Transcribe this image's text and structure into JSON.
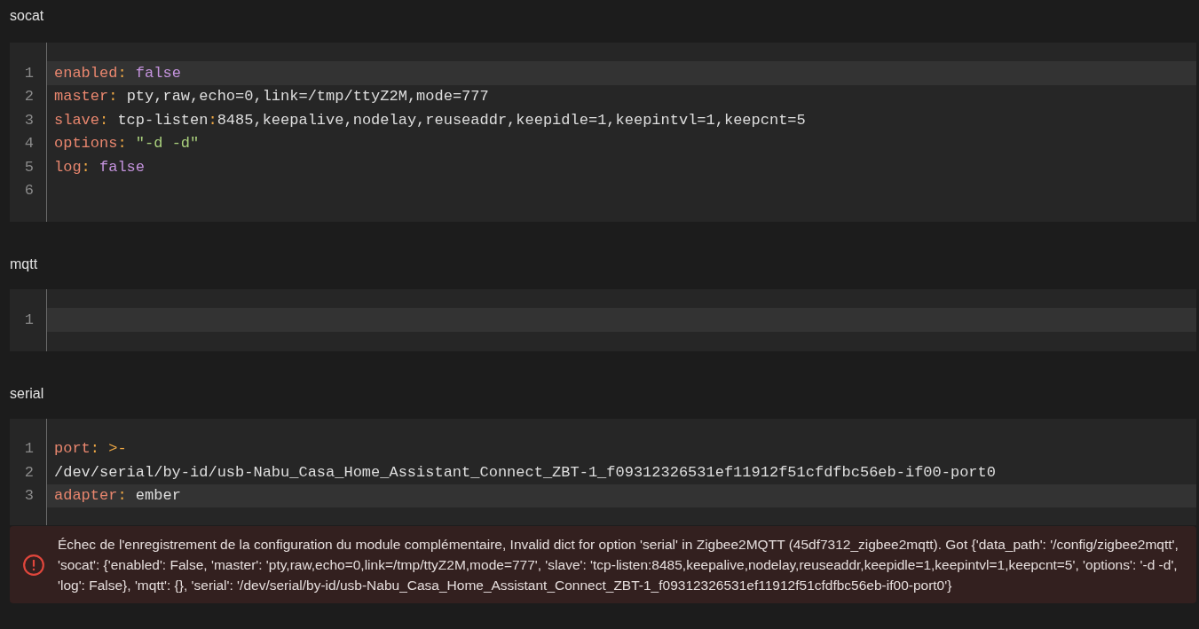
{
  "sections": [
    {
      "title": "socat",
      "lines": [
        {
          "number": "1",
          "active": true,
          "tokens": [
            {
              "kind": "key",
              "text": "enabled"
            },
            {
              "kind": "punct",
              "text": ": "
            },
            {
              "kind": "bool",
              "text": "false"
            }
          ]
        },
        {
          "number": "2",
          "active": false,
          "tokens": [
            {
              "kind": "key",
              "text": "master"
            },
            {
              "kind": "punct",
              "text": ": "
            },
            {
              "kind": "plain",
              "text": "pty,raw,echo=0,link=/tmp/ttyZ2M,mode=777"
            }
          ]
        },
        {
          "number": "3",
          "active": false,
          "tokens": [
            {
              "kind": "key",
              "text": "slave"
            },
            {
              "kind": "punct",
              "text": ": "
            },
            {
              "kind": "plain",
              "text": "tcp-listen"
            },
            {
              "kind": "punct",
              "text": ":"
            },
            {
              "kind": "plain",
              "text": "8485,keepalive,nodelay,reuseaddr,keepidle=1,keepintvl=1,keepcnt=5"
            }
          ]
        },
        {
          "number": "4",
          "active": false,
          "tokens": [
            {
              "kind": "key",
              "text": "options"
            },
            {
              "kind": "punct",
              "text": ": "
            },
            {
              "kind": "string",
              "text": "\"-d -d\""
            }
          ]
        },
        {
          "number": "5",
          "active": false,
          "tokens": [
            {
              "kind": "key",
              "text": "log"
            },
            {
              "kind": "punct",
              "text": ": "
            },
            {
              "kind": "bool",
              "text": "false"
            }
          ]
        },
        {
          "number": "6",
          "active": false
        }
      ]
    },
    {
      "title": "mqtt",
      "lines": [
        {
          "number": "1",
          "active": true
        }
      ]
    },
    {
      "title": "serial",
      "lines": [
        {
          "number": "1",
          "active": false,
          "tokens": [
            {
              "kind": "key",
              "text": "port"
            },
            {
              "kind": "punct",
              "text": ": "
            },
            {
              "kind": "indicator",
              "text": ">-"
            }
          ]
        },
        {
          "number": "2",
          "active": false,
          "tokens": [
            {
              "kind": "plain",
              "text": "/dev/serial/by-id/usb-Nabu_Casa_Home_Assistant_Connect_ZBT-1_f09312326531ef11912f51cfdfbc56eb-if00-port0"
            }
          ]
        },
        {
          "number": "3",
          "active": true,
          "tokens": [
            {
              "kind": "key",
              "text": "adapter"
            },
            {
              "kind": "punct",
              "text": ": "
            },
            {
              "kind": "plain",
              "text": "ember"
            }
          ]
        }
      ]
    }
  ],
  "error": {
    "message": "Échec de l'enregistrement de la configuration du module complémentaire, Invalid dict for option 'serial' in Zigbee2MQTT (45df7312_zigbee2mqtt). Got {'data_path': '/config/zigbee2mqtt', 'socat': {'enabled': False, 'master': 'pty,raw,echo=0,link=/tmp/ttyZ2M,mode=777', 'slave': 'tcp-listen:8485,keepalive,nodelay,reuseaddr,keepidle=1,keepintvl=1,keepcnt=5', 'options': '-d -d', 'log': False}, 'mqtt': {}, 'serial': '/dev/serial/by-id/usb-Nabu_Casa_Home_Assistant_Connect_ZBT-1_f09312326531ef11912f51cfdfbc56eb-if00-port0'}"
  }
}
